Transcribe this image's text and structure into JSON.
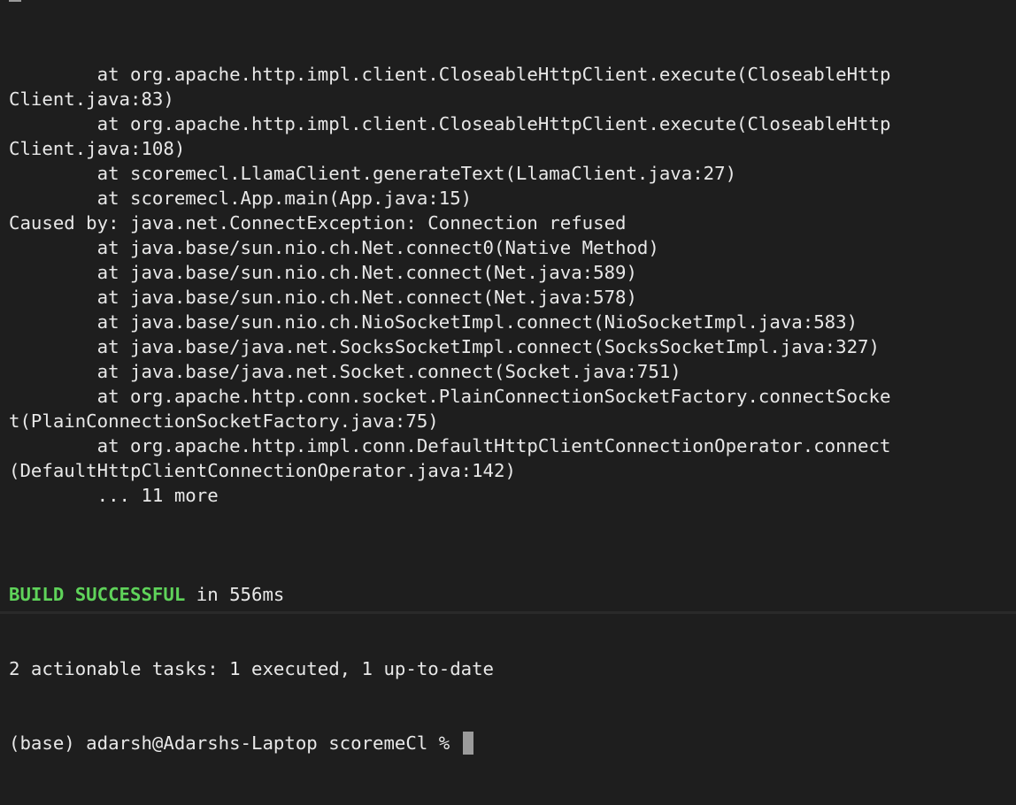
{
  "terminal": {
    "lines": [
      "        at org.apache.http.impl.client.CloseableHttpClient.execute(CloseableHttp",
      "Client.java:83)",
      "        at org.apache.http.impl.client.CloseableHttpClient.execute(CloseableHttp",
      "Client.java:108)",
      "        at scoremecl.LlamaClient.generateText(LlamaClient.java:27)",
      "        at scoremecl.App.main(App.java:15)",
      "Caused by: java.net.ConnectException: Connection refused",
      "        at java.base/sun.nio.ch.Net.connect0(Native Method)",
      "        at java.base/sun.nio.ch.Net.connect(Net.java:589)",
      "        at java.base/sun.nio.ch.Net.connect(Net.java:578)",
      "        at java.base/sun.nio.ch.NioSocketImpl.connect(NioSocketImpl.java:583)",
      "        at java.base/java.net.SocksSocketImpl.connect(SocksSocketImpl.java:327)",
      "        at java.base/java.net.Socket.connect(Socket.java:751)",
      "        at org.apache.http.conn.socket.PlainConnectionSocketFactory.connectSocke",
      "t(PlainConnectionSocketFactory.java:75)",
      "        at org.apache.http.impl.conn.DefaultHttpClientConnectionOperator.connect",
      "(DefaultHttpClientConnectionOperator.java:142)",
      "        ... 11 more",
      ""
    ],
    "build_status": "BUILD SUCCESSFUL",
    "build_time": " in 556ms",
    "tasks_summary": "2 actionable tasks: 1 executed, 1 up-to-date",
    "prompt": "(base) adarsh@Adarshs-Laptop scoremeCl % "
  },
  "colors": {
    "background": "#1e1e1e",
    "text": "#e8e8e8",
    "success": "#5fd35a",
    "cursor": "#9b9b9b"
  }
}
